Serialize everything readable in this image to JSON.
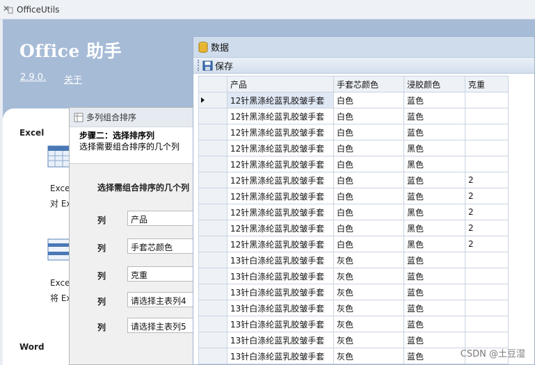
{
  "main_window": {
    "title": "OfficeUtils"
  },
  "header": {
    "title": "Office 助手",
    "version_link": "2.9.0.",
    "about_link": "关于"
  },
  "left_panel": {
    "excel_label": "Excel",
    "tool1_title": "Exce",
    "tool1_desc": "对 Ex",
    "tool2_title": "Exce",
    "tool2_desc": "将 Ex",
    "word_label": "Word"
  },
  "sort_dialog": {
    "title": "多列组合排序",
    "step_heading": "步骤二：选择排序列",
    "step_desc": "选择需要组合排序的几个列",
    "prompt": "选择需组合排序的几个列",
    "rows": [
      {
        "label": "列",
        "value": "产品"
      },
      {
        "label": "列",
        "value": "手套芯颜色"
      },
      {
        "label": "列",
        "value": "克重"
      },
      {
        "label": "列",
        "value": "请选择主表列4"
      },
      {
        "label": "列",
        "value": "请选择主表列5"
      }
    ]
  },
  "data_window": {
    "title": "数据",
    "toolbar": {
      "save_label": "保存"
    },
    "columns": [
      "产品",
      "手套芯颜色",
      "浸胶颜色",
      "克重"
    ],
    "rows": [
      [
        "12针黑涤纶蓝乳胶皱手套",
        "白色",
        "蓝色",
        ""
      ],
      [
        "12针黑涤纶蓝乳胶皱手套",
        "白色",
        "蓝色",
        ""
      ],
      [
        "12针黑涤纶蓝乳胶皱手套",
        "白色",
        "蓝色",
        ""
      ],
      [
        "12针黑涤纶蓝乳胶皱手套",
        "白色",
        "黑色",
        ""
      ],
      [
        "12针黑涤纶蓝乳胶皱手套",
        "白色",
        "黑色",
        ""
      ],
      [
        "12针黑涤纶蓝乳胶皱手套",
        "白色",
        "蓝色",
        "2"
      ],
      [
        "12针黑涤纶蓝乳胶皱手套",
        "白色",
        "蓝色",
        "2"
      ],
      [
        "12针黑涤纶蓝乳胶皱手套",
        "白色",
        "黑色",
        "2"
      ],
      [
        "12针黑涤纶蓝乳胶皱手套",
        "白色",
        "黑色",
        "2"
      ],
      [
        "12针黑涤纶蓝乳胶皱手套",
        "白色",
        "黑色",
        "2"
      ],
      [
        "13针白涤纶蓝乳胶皱手套",
        "灰色",
        "蓝色",
        ""
      ],
      [
        "13针白涤纶蓝乳胶皱手套",
        "灰色",
        "蓝色",
        ""
      ],
      [
        "13针白涤纶蓝乳胶皱手套",
        "灰色",
        "蓝色",
        ""
      ],
      [
        "13针白涤纶蓝乳胶皱手套",
        "灰色",
        "蓝色",
        ""
      ],
      [
        "13针白涤纶蓝乳胶皱手套",
        "灰色",
        "蓝色",
        ""
      ],
      [
        "13针白涤纶蓝乳胶皱手套",
        "灰色",
        "蓝色",
        ""
      ],
      [
        "13针白涤纶蓝乳胶皱手套",
        "灰色",
        "蓝色",
        ""
      ]
    ],
    "selected_row": 0
  },
  "watermark": "CSDN @土豆湿",
  "colors": {
    "header_blue": "#a6bbd6",
    "grid_border": "#c9d3e0",
    "selection": "#dfe8f4"
  }
}
